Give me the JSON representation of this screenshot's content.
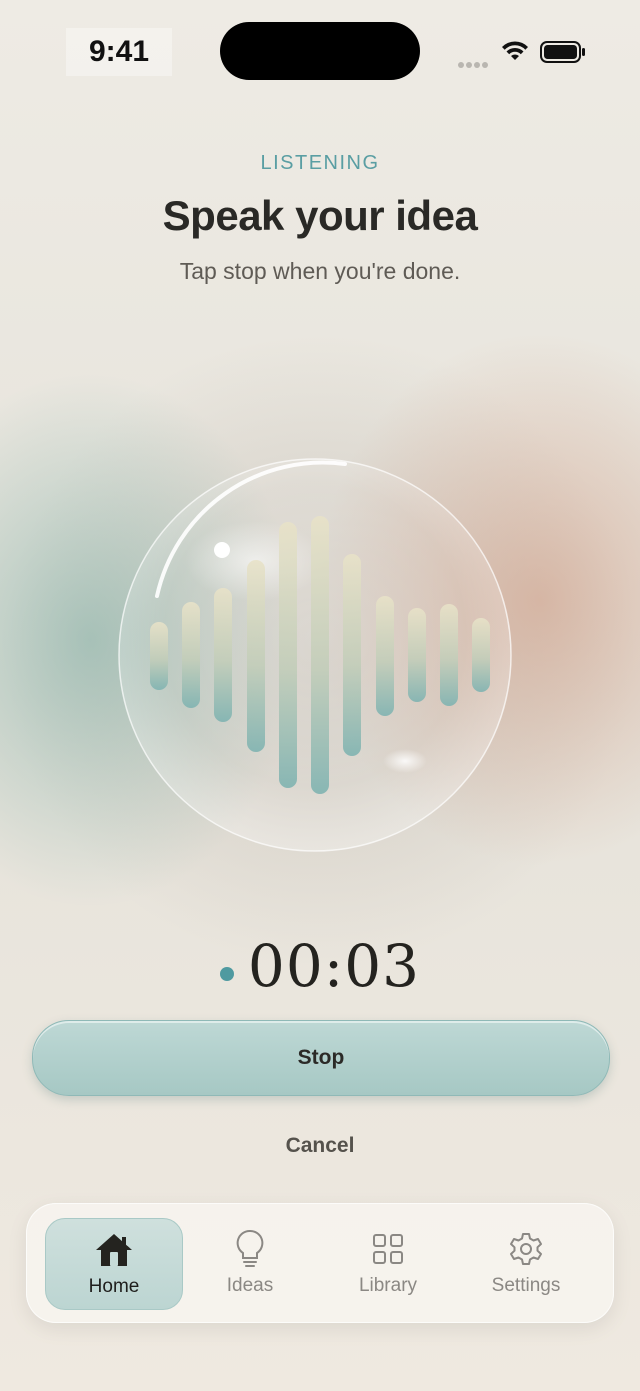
{
  "status_bar": {
    "time": "9:41"
  },
  "header": {
    "eyebrow": "LISTENING",
    "title": "Speak your idea",
    "subtitle": "Tap stop when you're done."
  },
  "recorder": {
    "elapsed": "00:03"
  },
  "actions": {
    "stop_label": "Stop",
    "cancel_label": "Cancel"
  },
  "tab_bar": {
    "tabs": [
      {
        "label": "Home",
        "icon": "home-icon",
        "active": true
      },
      {
        "label": "Ideas",
        "icon": "lightbulb-icon",
        "active": false
      },
      {
        "label": "Library",
        "icon": "grid-icon",
        "active": false
      },
      {
        "label": "Settings",
        "icon": "gear-icon",
        "active": false
      }
    ]
  },
  "colors": {
    "accent": "#5a9ea3",
    "button": "#b3d0cd",
    "text_dark": "#2a2926"
  }
}
